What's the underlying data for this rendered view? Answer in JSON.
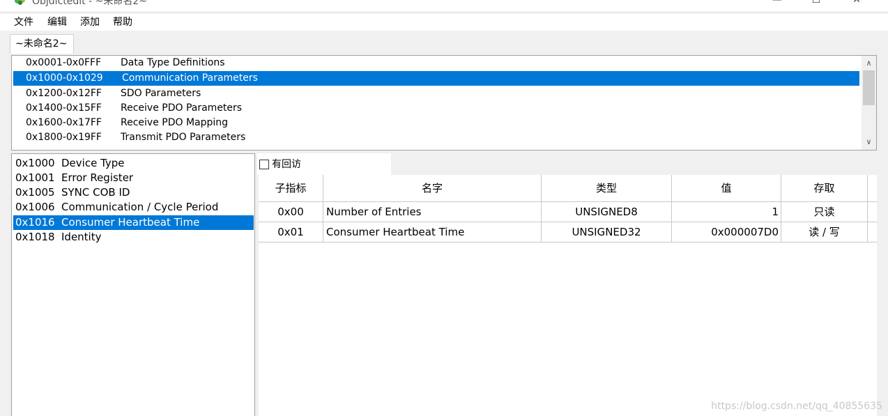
{
  "window": {
    "title": "Objdictedit - ~未命名2~",
    "controls": {
      "minimize": "—",
      "maximize": "☐",
      "close": "✕"
    }
  },
  "menu": [
    "文件",
    "编辑",
    "添加",
    "帮助"
  ],
  "tab": {
    "label": "~未命名2~"
  },
  "ranges": [
    {
      "code": "0x0001-0x0FFF",
      "desc": "Data Type Definitions"
    },
    {
      "code": "0x1000-0x1029",
      "desc": "Communication Parameters",
      "selected": true
    },
    {
      "code": "0x1200-0x12FF",
      "desc": "SDO Parameters"
    },
    {
      "code": "0x1400-0x15FF",
      "desc": "Receive PDO Parameters"
    },
    {
      "code": "0x1600-0x17FF",
      "desc": "Receive PDO Mapping"
    },
    {
      "code": "0x1800-0x19FF",
      "desc": "Transmit PDO Parameters"
    }
  ],
  "indexes": [
    {
      "code": "0x1000",
      "name": "Device Type"
    },
    {
      "code": "0x1001",
      "name": "Error Register"
    },
    {
      "code": "0x1005",
      "name": "SYNC COB ID"
    },
    {
      "code": "0x1006",
      "name": "Communication / Cycle Period"
    },
    {
      "code": "0x1016",
      "name": "Consumer Heartbeat Time",
      "selected": true
    },
    {
      "code": "0x1018",
      "name": "Identity"
    }
  ],
  "callback_checkbox": {
    "label": "有回访",
    "checked": false
  },
  "grid": {
    "headers": [
      "子指标",
      "名字",
      "类型",
      "值",
      "存取"
    ],
    "rows": [
      [
        "0x00",
        "Number of Entries",
        "UNSIGNED8",
        "1",
        "只读"
      ],
      [
        "0x01",
        "Consumer Heartbeat Time",
        "UNSIGNED32",
        "0x000007D0",
        "读 / 写"
      ]
    ]
  },
  "watermark": "https://blog.csdn.net/qq_40855635",
  "colors": {
    "selection": "#0078d7",
    "selection_text": "#ffffff"
  }
}
